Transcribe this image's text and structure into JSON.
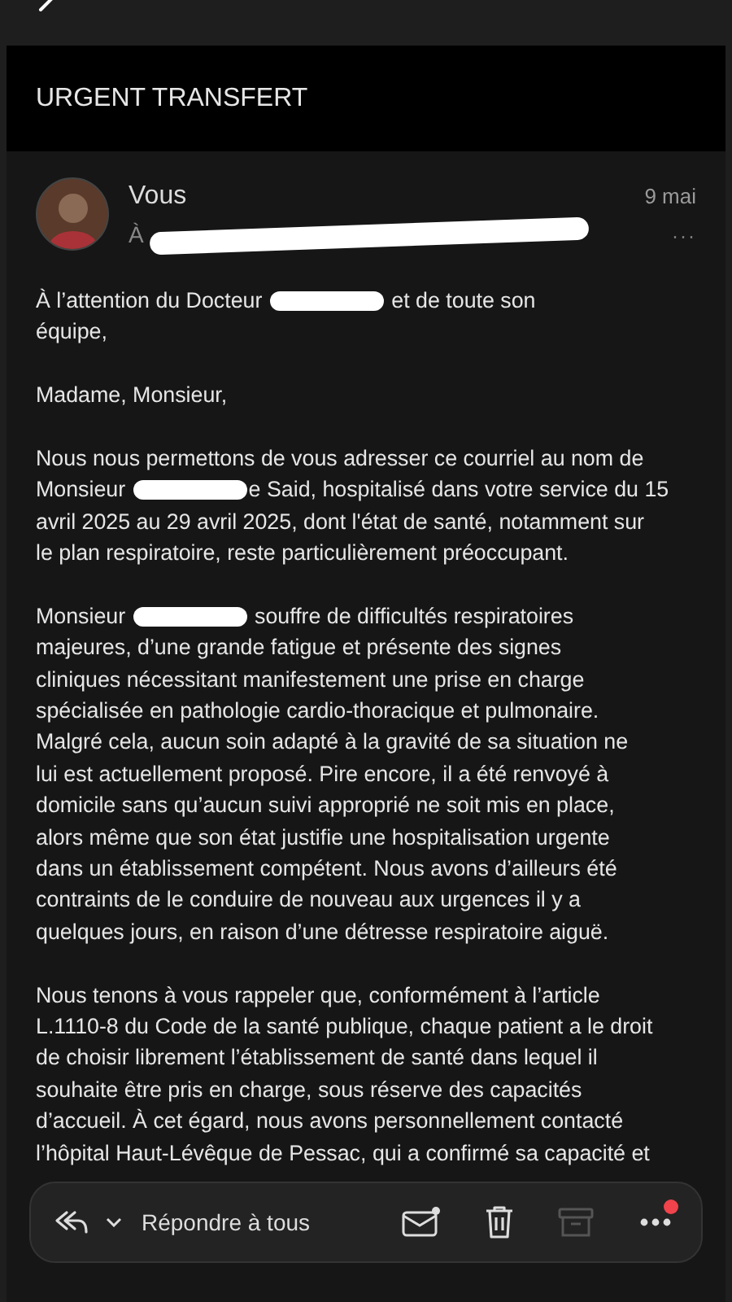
{
  "subject": "URGENT TRANSFERT",
  "message": {
    "sender": "Vous",
    "to_prefix": "À",
    "date": "9 mai",
    "more": "···"
  },
  "paragraphs": [
    [
      [
        {
          "text": "À l’attention du Docteur "
        },
        {
          "kind": "redaction"
        },
        {
          "text": " et de toute son"
        }
      ],
      [
        {
          "text": "équipe,"
        }
      ]
    ],
    [
      [
        {
          "text": "Madame, Monsieur,"
        }
      ]
    ],
    [
      [
        {
          "text": "Nous nous permettons de vous adresser ce courriel au nom de"
        }
      ],
      [
        {
          "text": "Monsieur "
        },
        {
          "kind": "redaction"
        },
        {
          "text": "e Said, hospitalisé dans votre service du 15"
        }
      ],
      [
        {
          "text": "avril 2025 au 29 avril 2025, dont l'état de santé, notamment sur"
        }
      ],
      [
        {
          "text": "le plan respiratoire, reste particulièrement préoccupant."
        }
      ]
    ],
    [
      [
        {
          "text": "Monsieur "
        },
        {
          "kind": "redaction"
        },
        {
          "text": " souffre de difficultés respiratoires"
        }
      ],
      [
        {
          "text": "majeures, d’une grande fatigue et présente des signes"
        }
      ],
      [
        {
          "text": "cliniques nécessitant manifestement une prise en charge"
        }
      ],
      [
        {
          "text": "spécialisée en pathologie cardio-thoracique et pulmonaire."
        }
      ],
      [
        {
          "text": "Malgré cela, aucun soin adapté à la gravité de sa situation ne"
        }
      ],
      [
        {
          "text": "lui est actuellement proposé. Pire encore, il a été renvoyé à"
        }
      ],
      [
        {
          "text": "domicile sans qu’aucun suivi approprié ne soit mis en place,"
        }
      ],
      [
        {
          "text": "alors même que son état justifie une hospitalisation urgente"
        }
      ],
      [
        {
          "text": "dans un établissement compétent. Nous avons d’ailleurs été"
        }
      ],
      [
        {
          "text": "contraints de le conduire de nouveau aux urgences il y a"
        }
      ],
      [
        {
          "text": "quelques jours, en raison d’une détresse respiratoire aiguë."
        }
      ]
    ],
    [
      [
        {
          "text": "Nous tenons à vous rappeler que, conformément à l’article"
        }
      ],
      [
        {
          "text": "L.1110-8 du Code de la santé publique, chaque patient a le droit"
        }
      ],
      [
        {
          "text": "de choisir librement l’établissement de santé dans lequel il"
        }
      ],
      [
        {
          "text": "souhaite être pris en charge, sous réserve des capacités"
        }
      ],
      [
        {
          "text": "d’accueil. À cet égard, nous avons personnellement contacté"
        }
      ],
      [
        {
          "text": "l’hôpital Haut-Lévêque de Pessac, qui a confirmé sa capacité et"
        }
      ]
    ]
  ],
  "toolbar": {
    "reply_label": "Répondre à tous",
    "unread_dot": true,
    "archive_disabled": true,
    "more_badge": true
  }
}
